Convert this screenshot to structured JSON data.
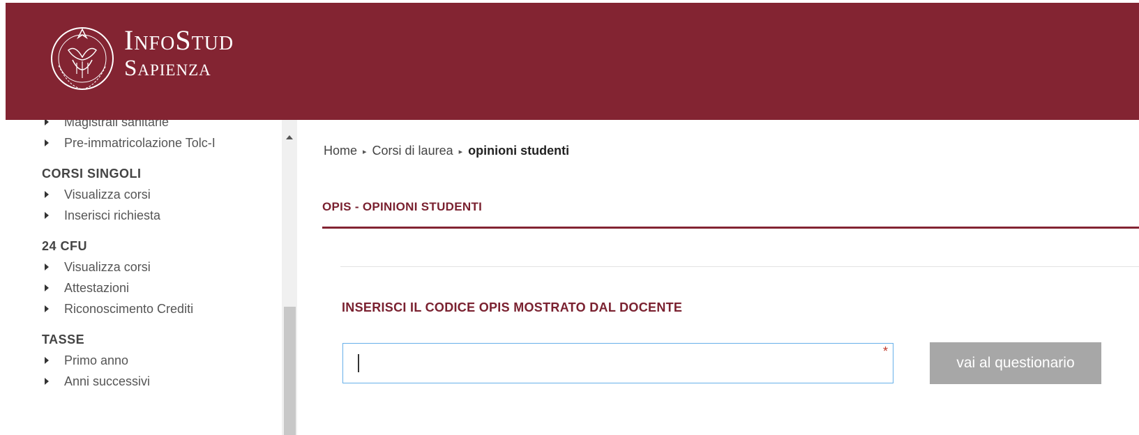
{
  "header": {
    "logo_line1": "InfoStud",
    "logo_line2": "Sapienza",
    "logo_seal_text": "STVDIVM VRBIS",
    "bg_color": "#832432"
  },
  "sidebar": {
    "top_items": [
      {
        "label": "Magistrali sanitarie"
      },
      {
        "label": "Pre-immatricolazione Tolc-I"
      }
    ],
    "sections": [
      {
        "heading": "CORSI SINGOLI",
        "items": [
          {
            "label": "Visualizza corsi"
          },
          {
            "label": "Inserisci richiesta"
          }
        ]
      },
      {
        "heading": "24 CFU",
        "items": [
          {
            "label": "Visualizza corsi"
          },
          {
            "label": "Attestazioni"
          },
          {
            "label": "Riconoscimento Crediti"
          }
        ]
      },
      {
        "heading": "TASSE",
        "items": [
          {
            "label": "Primo anno"
          },
          {
            "label": "Anni successivi"
          }
        ]
      }
    ]
  },
  "breadcrumb": {
    "home": "Home",
    "level1": "Corsi di laurea",
    "current": "opinioni studenti"
  },
  "main": {
    "section_title": "OPIS - OPINIONI STUDENTI",
    "field_label": "INSERISCI IL CODICE OPIS MOSTRATO DAL DOCENTE",
    "input_value": "",
    "required_mark": "*",
    "submit_label": "vai al questionario"
  }
}
